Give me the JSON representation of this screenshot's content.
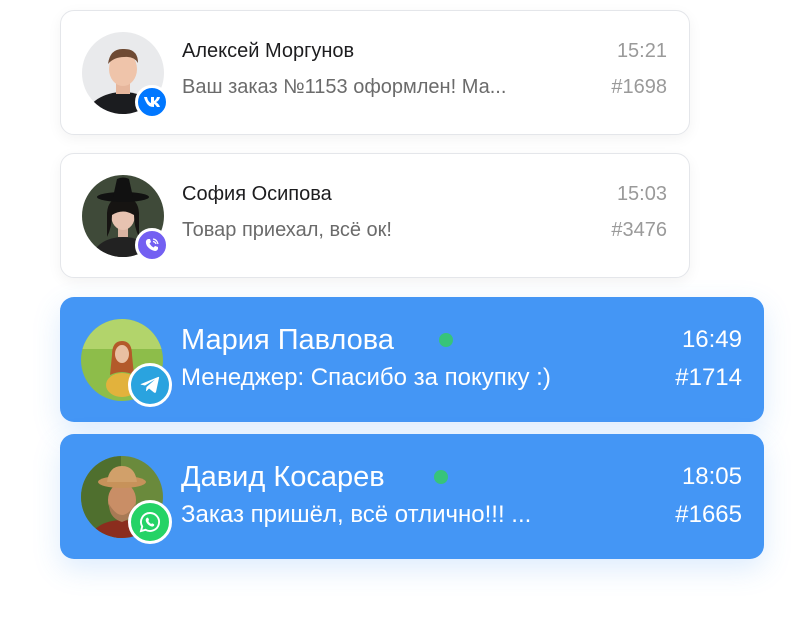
{
  "chats": [
    {
      "name": "Алексей Моргунов",
      "preview": "Ваш заказ №1153 оформлен! Ма...",
      "time": "15:21",
      "order": "#1698",
      "messenger": "vk-icon",
      "active": false,
      "online": false
    },
    {
      "name": "София Осипова",
      "preview": "Товар приехал, всё ок!",
      "time": "15:03",
      "order": "#3476",
      "messenger": "viber-icon",
      "active": false,
      "online": false
    },
    {
      "name": "Мария Павлова",
      "preview": "Менеджер:  Спасибо за покупку :)",
      "time": "16:49",
      "order": "#1714",
      "messenger": "telegram-icon",
      "active": true,
      "online": true
    },
    {
      "name": "Давид Косарев",
      "preview": "Заказ пришёл, всё отлично!!! ...",
      "time": "18:05",
      "order": "#1665",
      "messenger": "whatsapp-icon",
      "active": true,
      "online": true
    }
  ],
  "colors": {
    "active_card": "#4496f5",
    "online": "#37c47a",
    "vk": "#0077ff",
    "viber": "#7360f2",
    "telegram": "#2aa3df",
    "whatsapp": "#25d366"
  }
}
